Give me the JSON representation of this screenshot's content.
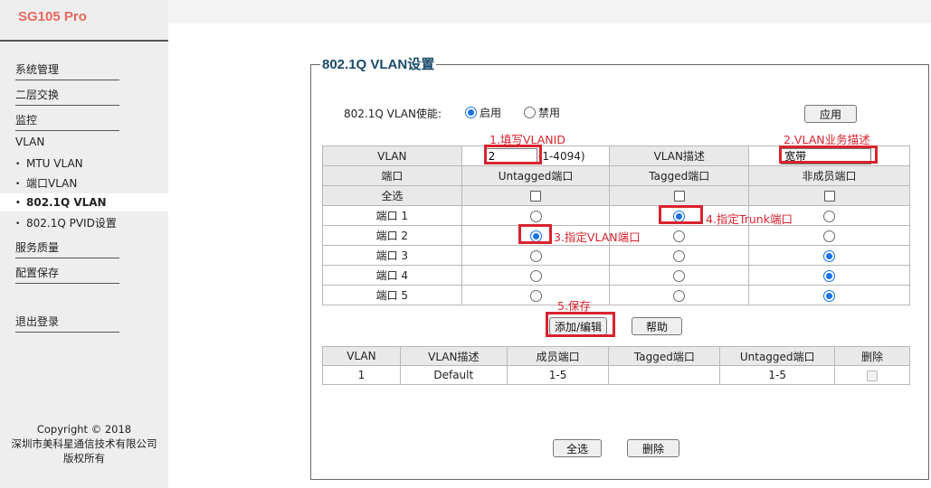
{
  "sidebar": {
    "brand": "SG105 Pro",
    "items": [
      {
        "label": "系统管理"
      },
      {
        "label": "二层交换"
      },
      {
        "label": "监控"
      },
      {
        "label": "VLAN"
      },
      {
        "label": "MTU VLAN"
      },
      {
        "label": "端口VLAN"
      },
      {
        "label": "802.1Q VLAN"
      },
      {
        "label": "802.1Q PVID设置"
      },
      {
        "label": "服务质量"
      },
      {
        "label": "配置保存"
      },
      {
        "label": "退出登录"
      }
    ],
    "copyright": [
      "Copyright © 2018",
      "深圳市美科星通信技术有限公司",
      "版权所有"
    ]
  },
  "main": {
    "legend": "802.1Q VLAN设置",
    "enable": {
      "label": "802.1Q VLAN使能:",
      "options": [
        "启用",
        "禁用"
      ],
      "selected": "启用"
    },
    "apply_label": "应用",
    "table": {
      "header": {
        "vlan_label": "VLAN",
        "vlan_value": "2",
        "vlan_hint": "(1-4094)",
        "desc_label": "VLAN描述",
        "desc_value": "宽带"
      },
      "columns": [
        "端口",
        "Untagged端口",
        "Tagged端口",
        "非成员端口"
      ],
      "select_all": "全选",
      "ports": [
        {
          "name": "端口 1",
          "mode": "tagged"
        },
        {
          "name": "端口 2",
          "mode": "untagged"
        },
        {
          "name": "端口 3",
          "mode": "nonmember"
        },
        {
          "name": "端口 4",
          "mode": "nonmember"
        },
        {
          "name": "端口 5",
          "mode": "nonmember"
        }
      ]
    },
    "add_edit_label": "添加/编辑",
    "help_label": "帮助",
    "list": {
      "columns": [
        "VLAN",
        "VLAN描述",
        "成员端口",
        "Tagged端口",
        "Untagged端口",
        "删除"
      ],
      "rows": [
        {
          "vlan": "1",
          "desc": "Default",
          "members": "1-5",
          "tagged": "",
          "untagged": "1-5"
        }
      ]
    },
    "select_all_label": "全选",
    "delete_label": "删除"
  },
  "annotations": {
    "a1": "1.填写VLANID",
    "a2": "2.VLAN业务描述",
    "a3": "3.指定VLAN端口",
    "a4": "4.指定Trunk端口",
    "a5": "5.保存",
    "color": "#d9232e"
  },
  "colors": {
    "brand": "#e8685e",
    "legend": "#1a4a6a",
    "radio_on": "#1a73e8"
  }
}
